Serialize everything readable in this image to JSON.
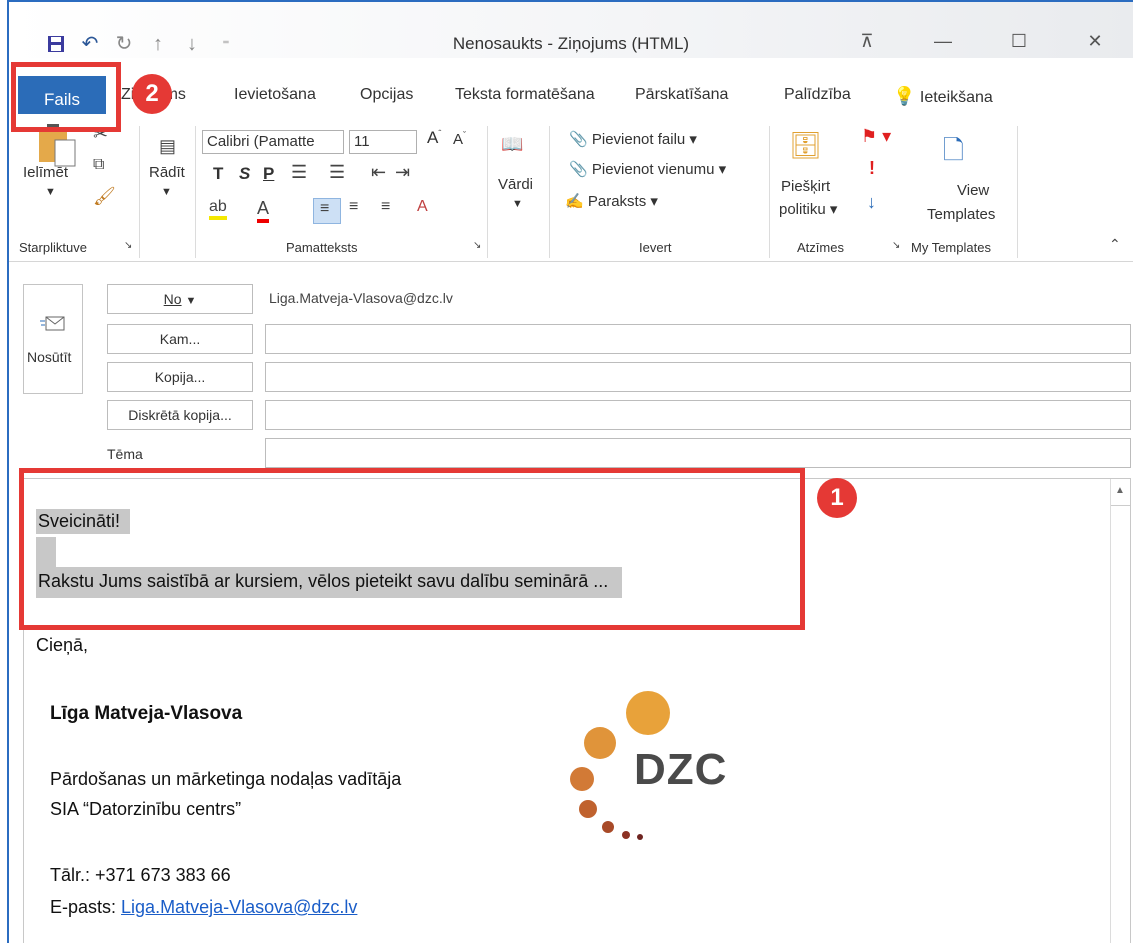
{
  "window": {
    "title": "Nenosaukts  -  Ziņojums (HTML)"
  },
  "qat": {
    "customize": "⁼"
  },
  "tabs": {
    "file": "Fails",
    "message": "Ziņojums",
    "insert": "Ievietošana",
    "options": "Opcijas",
    "format": "Teksta formatēšana",
    "review": "Pārskatīšana",
    "help": "Palīdzība",
    "tellme": "Ieteikšana"
  },
  "annotations": {
    "one": "1",
    "two": "2"
  },
  "ribbon": {
    "paste": "Ielīmēt",
    "clipboard_group": "Starpliktuve",
    "show": "Rādīt",
    "font_name": "Calibri (Pamatte",
    "font_size": "11",
    "bold": "T",
    "italic": "S",
    "underline": "P",
    "basic_text_group": "Pamatteksts",
    "names": "Vārdi",
    "attach_file": "Pievienot failu",
    "attach_item": "Pievienot vienumu",
    "signature": "Paraksts",
    "insert_group": "Ievert",
    "assign_policy_1": "Piešķirt",
    "assign_policy_2": "politiku",
    "tags_group": "Atzīmes",
    "view_templates_1": "View",
    "view_templates_2": "Templates",
    "my_templates_group": "My Templates"
  },
  "header": {
    "send": "Nosūtīt",
    "from_label": "No",
    "from_value": "Liga.Matveja-Vlasova@dzc.lv",
    "to_label": "Kam...",
    "cc_label": "Kopija...",
    "bcc_label": "Diskrētā kopija...",
    "subject_label": "Tēma"
  },
  "body": {
    "greeting": "Sveicināti!",
    "line": "Rakstu Jums saistībā ar kursiem, vēlos pieteikt savu dalību seminārā ...",
    "closing": "Cieņā,",
    "name": "Līga Matveja-Vlasova",
    "position": "Pārdošanas un mārketinga nodaļas vadītāja",
    "company": "SIA “Datorzinību centrs”",
    "phone": "Tālr.: +371 673 383 66",
    "email_label": "E-pasts: ",
    "email": "Liga.Matveja-Vlasova@dzc.lv",
    "logo_text": "DZC"
  },
  "colors": {
    "file_tab": "#2b6cb8",
    "annotation_red": "#e53935",
    "link": "#1a5dc8",
    "logo_orange": "#e8a23a"
  }
}
